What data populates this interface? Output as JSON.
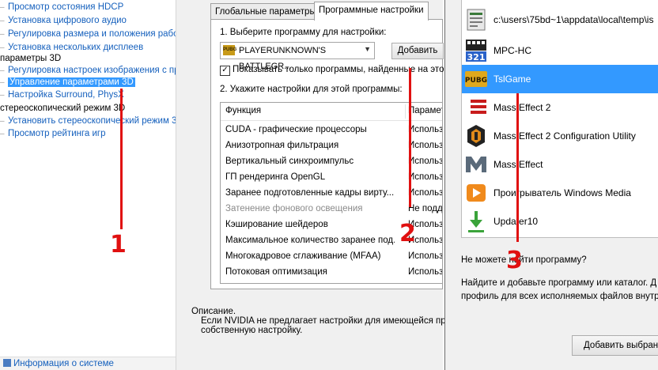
{
  "tree": {
    "items": [
      {
        "label": "Просмотр состояния HDCP",
        "kind": "link"
      },
      {
        "label": "Установка цифрового аудио",
        "kind": "link"
      },
      {
        "label": "Регулировка размера и положения рабоч",
        "kind": "link"
      },
      {
        "label": "Установка нескольких дисплеев",
        "kind": "link"
      },
      {
        "label": "параметры 3D",
        "kind": "category"
      },
      {
        "label": "Регулировка настроек изображения с пр",
        "kind": "link"
      },
      {
        "label": "Управление параметрами 3D",
        "kind": "link-selected"
      },
      {
        "label": "Настройка Surround, PhysX",
        "kind": "link"
      },
      {
        "label": "стереоскопический режим 3D",
        "kind": "category"
      },
      {
        "label": "Установить стереоскопический режим 3",
        "kind": "link"
      },
      {
        "label": "Просмотр рейтинга игр",
        "kind": "link"
      }
    ],
    "footer_link": "Информация о системе"
  },
  "tabs": {
    "global": "Глобальные параметры",
    "program": "Программные настройки"
  },
  "program_settings": {
    "step1": "1. Выберите программу для настройки:",
    "selected_program": "PLAYERUNKNOWN'S BATTLEGR...",
    "add_button": "Добавить",
    "checkbox_label": "Показывать только программы, найденные на этом",
    "checkbox_checked": true,
    "step2": "2. Укажите настройки для этой программы:",
    "columns": {
      "function": "Функция",
      "param": "Параметр"
    },
    "rows": [
      {
        "f": "CUDA - графические процессоры",
        "p": "Использо",
        "disabled": false
      },
      {
        "f": "Анизотропная фильтрация",
        "p": "Использо",
        "disabled": false
      },
      {
        "f": "Вертикальный синхроимпульс",
        "p": "Использо",
        "disabled": false
      },
      {
        "f": "ГП рендеринга OpenGL",
        "p": "Использо",
        "disabled": false
      },
      {
        "f": "Заранее подготовленные кадры вирту...",
        "p": "Использо",
        "disabled": false
      },
      {
        "f": "Затенение фонового освещения",
        "p": "Не подд",
        "disabled": true
      },
      {
        "f": "Кэширование шейдеров",
        "p": "Использо",
        "disabled": false
      },
      {
        "f": "Максимальное количество заранее под...",
        "p": "Использо",
        "disabled": false
      },
      {
        "f": "Многокадровое сглаживание (MFAA)",
        "p": "Использо",
        "disabled": false
      },
      {
        "f": "Потоковая оптимизация",
        "p": "Использо",
        "disabled": false
      }
    ]
  },
  "description": {
    "title": "Описание.",
    "line1": "Если NVIDIA не предлагает настройки для имеющейся прог",
    "line2": "собственную настройку."
  },
  "popup": {
    "programs": [
      {
        "name": "c:\\users\\75bd~1\\appdata\\local\\temp\\is",
        "icon": "document-icon"
      },
      {
        "name": "MPC-HC",
        "icon": "mpc-hc-icon"
      },
      {
        "name": "TslGame",
        "icon": "pubg-icon"
      },
      {
        "name": "Mass Effect 2",
        "icon": "mass-effect-2-icon"
      },
      {
        "name": "Mass Effect 2 Configuration Utility",
        "icon": "mass-effect-config-icon"
      },
      {
        "name": "Mass Effect",
        "icon": "mass-effect-icon"
      },
      {
        "name": "Проигрыватель Windows Media",
        "icon": "windows-media-player-icon"
      },
      {
        "name": "Updater10",
        "icon": "updater-icon"
      }
    ],
    "selected_index": 2,
    "cant_find": "Не можете найти программу?",
    "hint_line1": "Найдите и добавьте программу или каталог. Д",
    "hint_line2": "профиль для всех исполняемых файлов внутр",
    "add_selected_button": "Добавить выбран"
  },
  "annotations": {
    "n1": "1",
    "n2": "2",
    "n3": "3",
    "color": "#e01010"
  }
}
